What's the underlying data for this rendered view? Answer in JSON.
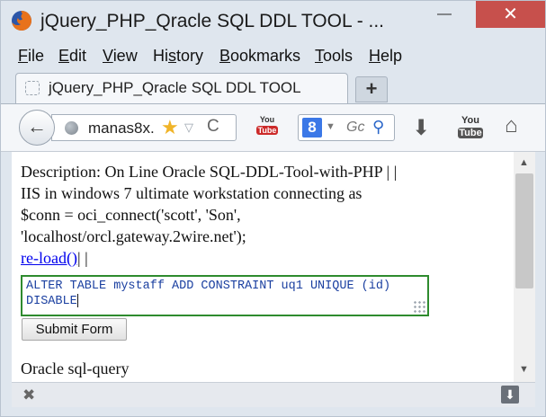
{
  "window": {
    "title": "jQuery_PHP_Qracle SQL DDL TOOL - ...",
    "close_glyph": "✕",
    "minimize_glyph": "—"
  },
  "menu": {
    "items": [
      {
        "first": "F",
        "rest": "ile"
      },
      {
        "first": "E",
        "rest": "dit"
      },
      {
        "first": "V",
        "rest": "iew"
      },
      {
        "first": "",
        "mid": "Hi",
        "u": "s",
        "rest": "tory"
      },
      {
        "first": "B",
        "rest": "ookmarks"
      },
      {
        "first": "T",
        "rest": "ools"
      },
      {
        "first": "H",
        "rest": "elp"
      }
    ]
  },
  "tab": {
    "label": "jQuery_PHP_Qracle SQL DDL TOOL",
    "new_tab": "+"
  },
  "navbar": {
    "back_glyph": "←",
    "url_text": "manas8x.",
    "star_glyph": "★",
    "dropdown_glyph": "▽",
    "reload_glyph": "C",
    "search_engine": "8",
    "search_placeholder": "Gc",
    "search_glyph": "⚲",
    "downloads_glyph": "⬇",
    "youtube_small_top": "You",
    "youtube_small_bottom": "Tube",
    "youtube_big_top": "You",
    "youtube_big_bottom": "Tube",
    "home_glyph": "⌂"
  },
  "content": {
    "description_line1": "Description: On Line Oracle SQL-DDL-Tool-with-PHP | |",
    "description_line2": "IIS in windows 7 ultimate workstation connecting as",
    "description_line3": "$conn = oci_connect('scott', 'Son',",
    "description_line4": "'localhost/orcl.gateway.2wire.net');",
    "reload_link": "re-load()",
    "reload_suffix": "| |",
    "sql_query": "ALTER TABLE mystaff ADD CONSTRAINT uq1 UNIQUE (id) DISABLE",
    "submit_label": "Submit Form",
    "oracle_label": "Oracle sql-query"
  },
  "scrollbar": {
    "up_glyph": "▲",
    "down_glyph": "▼"
  },
  "bottombar": {
    "close_glyph": "✖",
    "download_glyph": "⬇"
  },
  "colors": {
    "accent_close": "#c7504c",
    "textarea_border": "#2e8b2e",
    "link": "#0000ee",
    "sql_text": "#1a3fa0"
  }
}
